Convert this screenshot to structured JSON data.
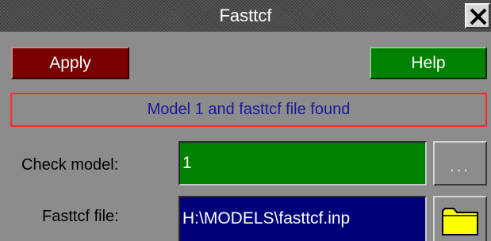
{
  "window": {
    "title": "Fasttcf",
    "close_icon": "close-icon"
  },
  "toolbar": {
    "apply_label": "Apply",
    "help_label": "Help"
  },
  "status": {
    "message": "Model 1 and fasttcf file found"
  },
  "form": {
    "check_model_label": "Check model:",
    "check_model_value": "1",
    "browse_label": "...",
    "fasttcf_file_label": "Fasttcf file:",
    "fasttcf_file_value": "H:\\MODELS\\fasttcf.inp",
    "folder_icon": "folder-icon"
  },
  "colors": {
    "title_bar": "#4a4a4a",
    "panel_bg": "#8c8c8c",
    "apply_bg": "#7a0000",
    "help_bg": "#008000",
    "status_border": "#ff2a2a",
    "status_text": "#1a1a9a",
    "check_model_bg": "#008000",
    "file_field_bg": "#00007a",
    "folder_fill": "#ffff00"
  }
}
